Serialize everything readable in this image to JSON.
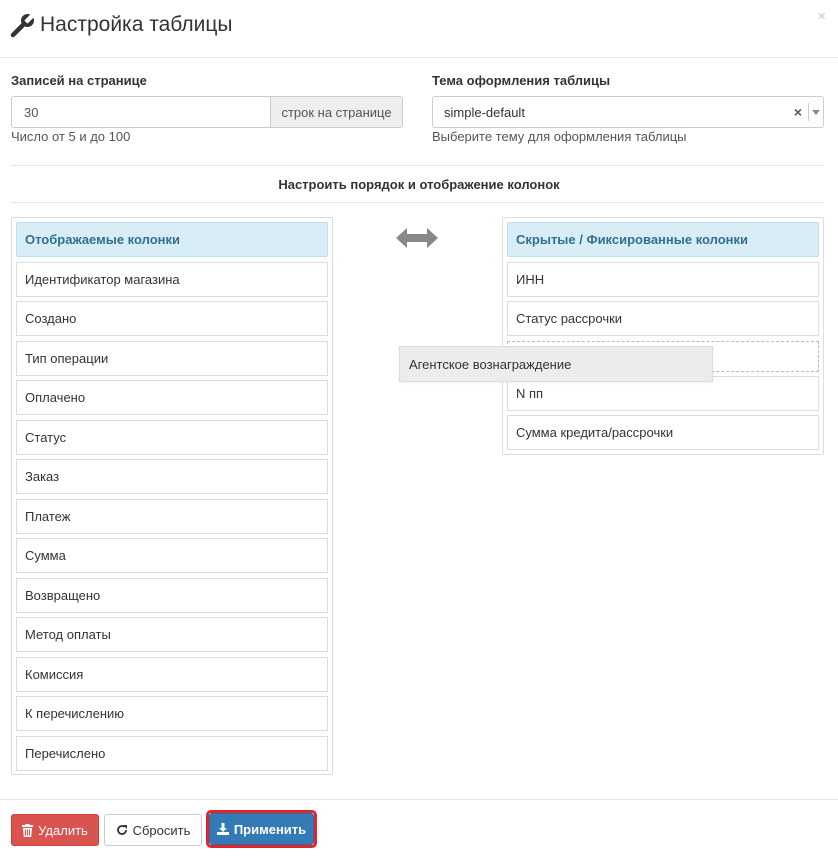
{
  "header": {
    "title": "Настройка таблицы",
    "close_label": "×"
  },
  "records": {
    "label": "Записей на странице",
    "value": "30",
    "addon": "строк на странице",
    "help": "Число от 5 и до 100"
  },
  "theme": {
    "label": "Тема оформления таблицы",
    "value": "simple-default",
    "clear": "×",
    "help": "Выберите тему для оформления таблицы"
  },
  "section_title": "Настроить порядок и отображение колонок",
  "visible_columns": {
    "header": "Отображаемые колонки",
    "items": [
      "Идентификатор магазина",
      "Создано",
      "Тип операции",
      "Оплачено",
      "Статус",
      "Заказ",
      "Платеж",
      "Сумма",
      "Возвращено",
      "Метод оплаты",
      "Комиссия",
      "К перечислению",
      "Перечислено"
    ]
  },
  "hidden_columns": {
    "header": "Скрытые / Фиксированные колонки",
    "items": [
      "ИНН",
      "Статус рассрочки",
      "N пп",
      "Сумма кредита/рассрочки"
    ]
  },
  "dragging_item": "Агентское вознаграждение",
  "footer": {
    "delete_label": "Удалить",
    "reset_label": "Сбросить",
    "apply_label": "Применить"
  },
  "colors": {
    "danger": "#d9534f",
    "primary": "#337ab7",
    "highlight": "#e0262b",
    "panel_head_bg": "#d9edf7",
    "panel_head_text": "#31708f"
  }
}
